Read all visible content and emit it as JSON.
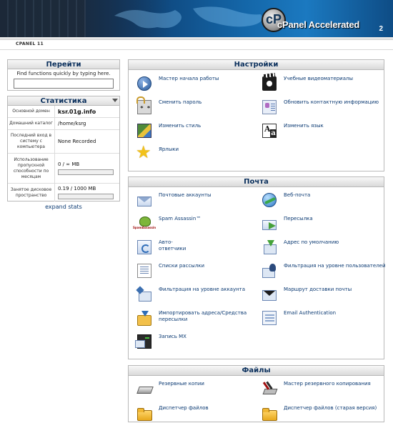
{
  "header": {
    "logo_text": "cPanel Accelerated",
    "logo_sub": "2",
    "version": "CPANEL 11"
  },
  "go": {
    "title": "Перейти",
    "hint": "Find functions quickly by typing here.",
    "value": ""
  },
  "stats": {
    "title": "Статистика",
    "rows": [
      {
        "label": "Основной домен",
        "value": "ksr.01g.info"
      },
      {
        "label": "Домашний каталог",
        "value": "/home/ksrg"
      },
      {
        "label": "Последний вход в систему с компьютера",
        "value": "None Recorded"
      },
      {
        "label": "Использование пропускной способности по месяцам",
        "value": "0 / ∞ MB",
        "fill": 0
      },
      {
        "label": "Занятое дисковое пространство",
        "value": "0.19 / 1000 MB",
        "fill": 0.0002
      }
    ],
    "expand_label": "expand stats"
  },
  "settings": {
    "title": "Настройки",
    "items": [
      {
        "label": "Мастер начала работы",
        "icon": "play-icon"
      },
      {
        "label": "Учебные видеоматериалы",
        "icon": "film-icon"
      },
      {
        "label": "Сменить пароль",
        "icon": "lock-icon"
      },
      {
        "label": "Обновить контактную информацию",
        "icon": "contact-card-icon"
      },
      {
        "label": "Изменить стиль",
        "icon": "style-icon"
      },
      {
        "label": "Изменить язык",
        "icon": "language-icon"
      },
      {
        "label": "Ярлыки",
        "icon": "star-icon"
      }
    ]
  },
  "mail": {
    "title": "Почта",
    "items": [
      {
        "label": "Почтовые аккаунты",
        "icon": "mail-icon"
      },
      {
        "label": "Веб-почта",
        "icon": "webmail-icon"
      },
      {
        "label": "Spam Assassin™",
        "icon": "spam-assassin-icon"
      },
      {
        "label": "Пересылка",
        "icon": "forward-icon"
      },
      {
        "label": "Авто-ответчики",
        "icon": "autoresponder-icon"
      },
      {
        "label": "Адрес по умолчанию",
        "icon": "default-address-icon"
      },
      {
        "label": "Списки рассылки",
        "icon": "mailing-list-icon"
      },
      {
        "label": "Фильтрация на уровне пользователей",
        "icon": "user-filter-icon"
      },
      {
        "label": "Фильтрация на уровне аккаунта",
        "icon": "account-filter-icon"
      },
      {
        "label": "Маршрут доставки почты",
        "icon": "mail-route-icon"
      },
      {
        "label": "Импортировать адреса/Средства пересылки",
        "icon": "import-icon"
      },
      {
        "label": "Email Authentication",
        "icon": "email-auth-icon"
      },
      {
        "label": "Запись MX",
        "icon": "mx-record-icon"
      }
    ]
  },
  "files": {
    "title": "Файлы",
    "items": [
      {
        "label": "Резервные копии",
        "icon": "backup-icon"
      },
      {
        "label": "Мастер резервного копирования",
        "icon": "backup-wizard-icon"
      },
      {
        "label": "Диспетчер файлов",
        "icon": "folder-icon"
      },
      {
        "label": "Диспетчер файлов (старая версия)",
        "icon": "folder-icon"
      }
    ]
  },
  "colors": {
    "link": "#0b3a73",
    "header_dark": "#081a33",
    "header_blue": "#1466a8"
  }
}
